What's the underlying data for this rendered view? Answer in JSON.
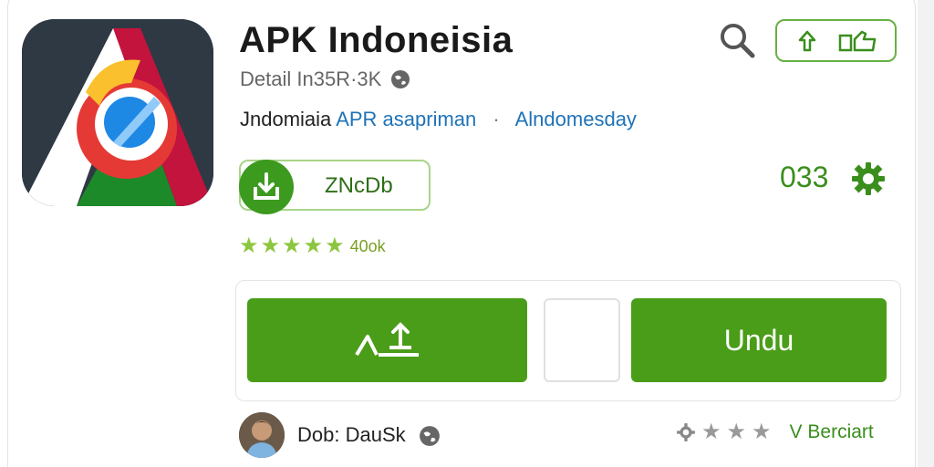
{
  "app": {
    "title": "APK Indoneisia",
    "meta": "Detail In35R·3K",
    "subtitle_text": "Jndomiaia",
    "subtitle_link": "APR asapriman",
    "subtitle_dot": "·",
    "subtitle_link2": "Alndomesday"
  },
  "download": {
    "label": "ZNcDb"
  },
  "count": "033",
  "rating": {
    "stars": 5,
    "count_text": "40ok"
  },
  "actions": {
    "right_label": "Undu"
  },
  "developer": {
    "label": "Dob: DauSk"
  },
  "footer": {
    "version_label": "V Berciart"
  },
  "colors": {
    "accent_green": "#4a9d18",
    "link_blue": "#1f73b7",
    "star_green": "#8cc63f"
  },
  "icons": {
    "search": "search-icon",
    "share": "share-icon",
    "thumbs": "thumbs-up-icon",
    "download": "download-icon",
    "gear": "gear-icon",
    "globe": "globe-icon",
    "upload": "upload-icon"
  }
}
